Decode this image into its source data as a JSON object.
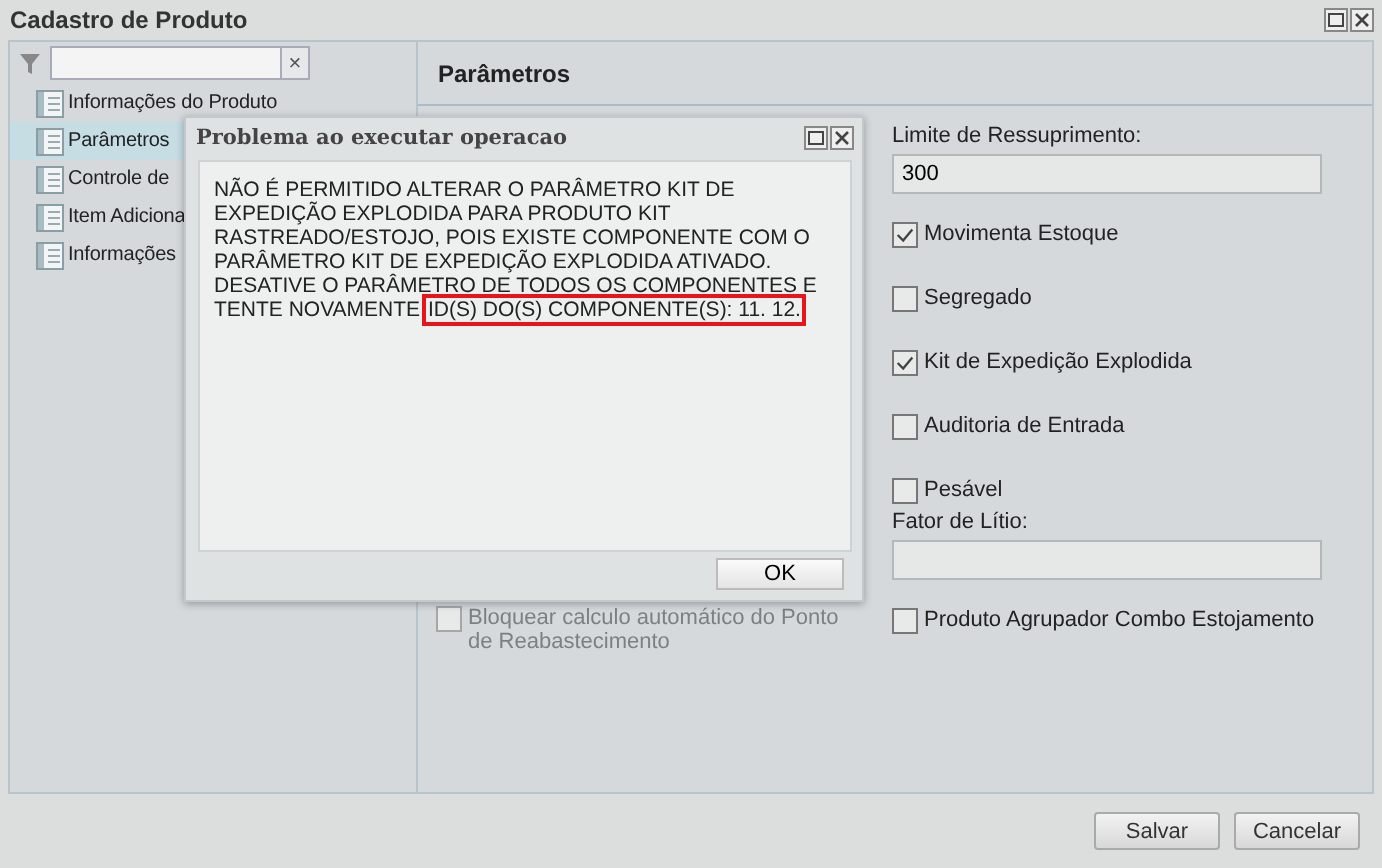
{
  "window": {
    "title": "Cadastro de Produto"
  },
  "sidebar": {
    "filter": {
      "clear_label": "×"
    },
    "items": [
      {
        "label": "Informações do Produto",
        "selected": false
      },
      {
        "label": "Parâmetros",
        "selected": true
      },
      {
        "label": "Controle de",
        "selected": false
      },
      {
        "label": "Item Adiciona",
        "selected": false
      },
      {
        "label": "Informações",
        "selected": false
      }
    ]
  },
  "panel": {
    "title": "Parâmetros",
    "left_fields": [
      {
        "kind": "checkbox",
        "label": "Bloquear calculo automático do Ponto de Reabastecimento",
        "checked": false,
        "disabled": true
      }
    ],
    "right_fields": [
      {
        "kind": "input",
        "label": "Limite de Ressuprimento:",
        "value": "300"
      },
      {
        "kind": "checkbox",
        "label": "Movimenta Estoque",
        "checked": true,
        "disabled": false
      },
      {
        "kind": "checkbox",
        "label": "Segregado",
        "checked": false,
        "disabled": false
      },
      {
        "kind": "checkbox",
        "label": "Kit de Expedição Explodida",
        "checked": true,
        "disabled": false
      },
      {
        "kind": "checkbox",
        "label": "Auditoria de Entrada",
        "checked": false,
        "disabled": false
      },
      {
        "kind": "checkbox",
        "label": "Pesável",
        "checked": false,
        "disabled": false
      },
      {
        "kind": "input",
        "label": "Fator de Lítio:"
      },
      {
        "kind": "checkbox",
        "label": "Produto Agrupador Combo Estojamento",
        "checked": false,
        "disabled": false
      }
    ]
  },
  "dialog": {
    "title": "Problema ao executar operacao",
    "message": "NÃO É PERMITIDO ALTERAR O PARÂMETRO KIT DE EXPEDIÇÃO EXPLODIDA PARA PRODUTO KIT RASTREADO/ESTOJO, POIS EXISTE COMPONENTE COM O PARÂMETRO KIT DE EXPEDIÇÃO EXPLODIDA ATIVADO. DESATIVE O PARÂMETRO DE TODOS OS COMPONENTES E TENTE NOVAMENTE",
    "highlighted_text": "ID(S) DO(S) COMPONENTE(S): 11. 12.",
    "ok_label": "OK"
  },
  "buttons": [
    "Salvar",
    "Cancelar"
  ]
}
